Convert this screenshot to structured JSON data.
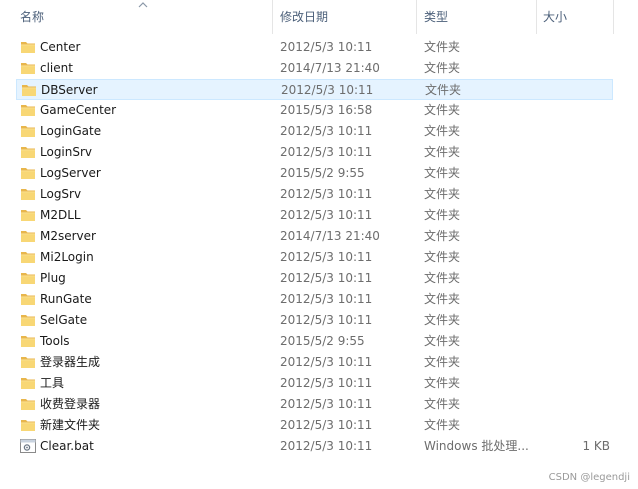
{
  "columns": {
    "name": "名称",
    "date": "修改日期",
    "type": "类型",
    "size": "大小"
  },
  "sort": {
    "column": "name",
    "icon": "sort-ascending-icon"
  },
  "rows": [
    {
      "name": "Center",
      "date": "2012/5/3 10:11",
      "type": "文件夹",
      "size": "",
      "icon": "folder-icon"
    },
    {
      "name": "client",
      "date": "2014/7/13 21:40",
      "type": "文件夹",
      "size": "",
      "icon": "folder-icon"
    },
    {
      "name": "DBServer",
      "date": "2012/5/3 10:11",
      "type": "文件夹",
      "size": "",
      "icon": "folder-icon",
      "selected": true
    },
    {
      "name": "GameCenter",
      "date": "2015/5/3 16:58",
      "type": "文件夹",
      "size": "",
      "icon": "folder-icon"
    },
    {
      "name": "LoginGate",
      "date": "2012/5/3 10:11",
      "type": "文件夹",
      "size": "",
      "icon": "folder-icon"
    },
    {
      "name": "LoginSrv",
      "date": "2012/5/3 10:11",
      "type": "文件夹",
      "size": "",
      "icon": "folder-icon"
    },
    {
      "name": "LogServer",
      "date": "2015/5/2 9:55",
      "type": "文件夹",
      "size": "",
      "icon": "folder-icon"
    },
    {
      "name": "LogSrv",
      "date": "2012/5/3 10:11",
      "type": "文件夹",
      "size": "",
      "icon": "folder-icon"
    },
    {
      "name": "M2DLL",
      "date": "2012/5/3 10:11",
      "type": "文件夹",
      "size": "",
      "icon": "folder-icon"
    },
    {
      "name": "M2server",
      "date": "2014/7/13 21:40",
      "type": "文件夹",
      "size": "",
      "icon": "folder-icon"
    },
    {
      "name": "Mi2Login",
      "date": "2012/5/3 10:11",
      "type": "文件夹",
      "size": "",
      "icon": "folder-icon"
    },
    {
      "name": "Plug",
      "date": "2012/5/3 10:11",
      "type": "文件夹",
      "size": "",
      "icon": "folder-icon"
    },
    {
      "name": "RunGate",
      "date": "2012/5/3 10:11",
      "type": "文件夹",
      "size": "",
      "icon": "folder-icon"
    },
    {
      "name": "SelGate",
      "date": "2012/5/3 10:11",
      "type": "文件夹",
      "size": "",
      "icon": "folder-icon"
    },
    {
      "name": "Tools",
      "date": "2015/5/2 9:55",
      "type": "文件夹",
      "size": "",
      "icon": "folder-icon"
    },
    {
      "name": "登录器生成",
      "date": "2012/5/3 10:11",
      "type": "文件夹",
      "size": "",
      "icon": "folder-icon"
    },
    {
      "name": "工具",
      "date": "2012/5/3 10:11",
      "type": "文件夹",
      "size": "",
      "icon": "folder-icon"
    },
    {
      "name": "收费登录器",
      "date": "2012/5/3 10:11",
      "type": "文件夹",
      "size": "",
      "icon": "folder-icon"
    },
    {
      "name": "新建文件夹",
      "date": "2012/5/3 10:11",
      "type": "文件夹",
      "size": "",
      "icon": "folder-icon"
    },
    {
      "name": "Clear.bat",
      "date": "2012/5/3 10:11",
      "type": "Windows 批处理...",
      "size": "1 KB",
      "icon": "batch-file-icon"
    }
  ],
  "watermark": "CSDN @legendji",
  "colors": {
    "header_text": "#4c607a",
    "folder": "#f8d775",
    "selection_bg": "#e5f3ff",
    "selection_border": "#cce8ff",
    "meta_text": "#6d6d6d"
  }
}
